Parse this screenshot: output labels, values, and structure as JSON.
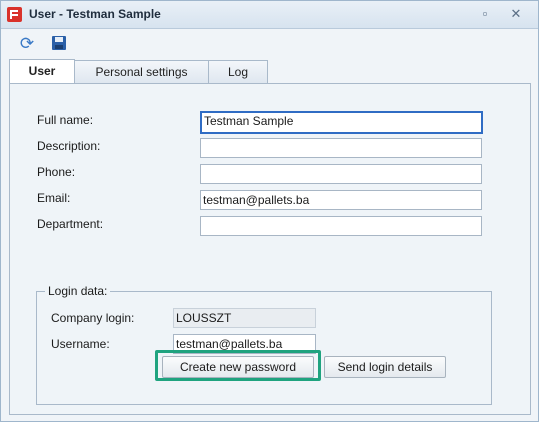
{
  "window": {
    "title": "User - Testman Sample",
    "restore_icon": "restore-icon",
    "close_icon": "close-icon"
  },
  "toolbar": {
    "refresh_icon": "refresh-icon",
    "save_icon": "save-icon"
  },
  "tabs": [
    {
      "label": "User",
      "active": true
    },
    {
      "label": "Personal settings",
      "active": false
    },
    {
      "label": "Log",
      "active": false
    }
  ],
  "form": {
    "full_name": {
      "label": "Full name:",
      "value": "Testman Sample"
    },
    "description": {
      "label": "Description:",
      "value": ""
    },
    "phone": {
      "label": "Phone:",
      "value": ""
    },
    "email": {
      "label": "Email:",
      "value": "testman@pallets.ba"
    },
    "department": {
      "label": "Department:",
      "value": ""
    }
  },
  "login": {
    "legend": "Login data:",
    "company_login": {
      "label": "Company login:",
      "value": "LOUSSZT"
    },
    "username": {
      "label": "Username:",
      "value": "testman@pallets.ba"
    },
    "create_password_label": "Create new password",
    "send_details_label": "Send login details"
  },
  "colors": {
    "highlight": "#1fa37f",
    "focus": "#2f6cc4"
  }
}
